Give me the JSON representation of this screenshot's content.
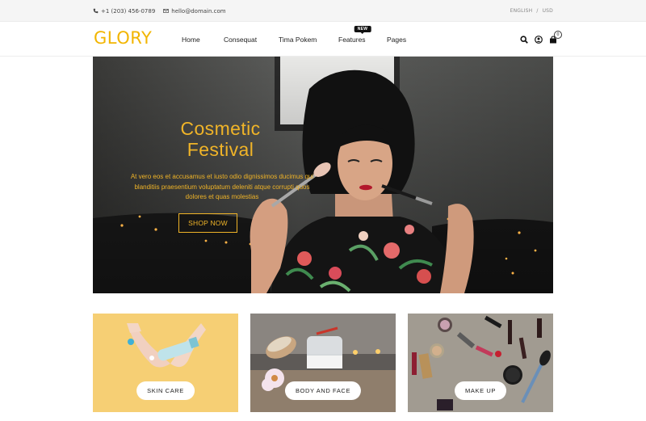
{
  "topbar": {
    "phone": "+1 (203) 456-0789",
    "email": "hello@domain.com",
    "language": "ENGLISH",
    "separator": "/",
    "currency": "USD"
  },
  "header": {
    "logo": "GLORY",
    "nav": [
      {
        "label": "Home"
      },
      {
        "label": "Consequat"
      },
      {
        "label": "Tima Pokem"
      },
      {
        "label": "Features",
        "badge": "NEW"
      },
      {
        "label": "Pages"
      }
    ],
    "icons": [
      "search-icon",
      "user-icon",
      "cart-icon"
    ],
    "cart_count": "0"
  },
  "hero": {
    "title_line1": "Cosmetic",
    "title_line2": "Festival",
    "subtitle": "At vero eos et accusamus et iusto odio dignissimos ducimus qui blanditiis praesentium voluptatum deleniti atque corrupti quos dolores et quas molestias",
    "button": "SHOP NOW"
  },
  "categories": [
    {
      "label": "SKIN CARE"
    },
    {
      "label": "BODY AND FACE"
    },
    {
      "label": "MAKE UP"
    }
  ],
  "colors": {
    "accent": "#f0b428",
    "logo": "#f2b500",
    "topbar_bg": "#f5f5f5"
  }
}
